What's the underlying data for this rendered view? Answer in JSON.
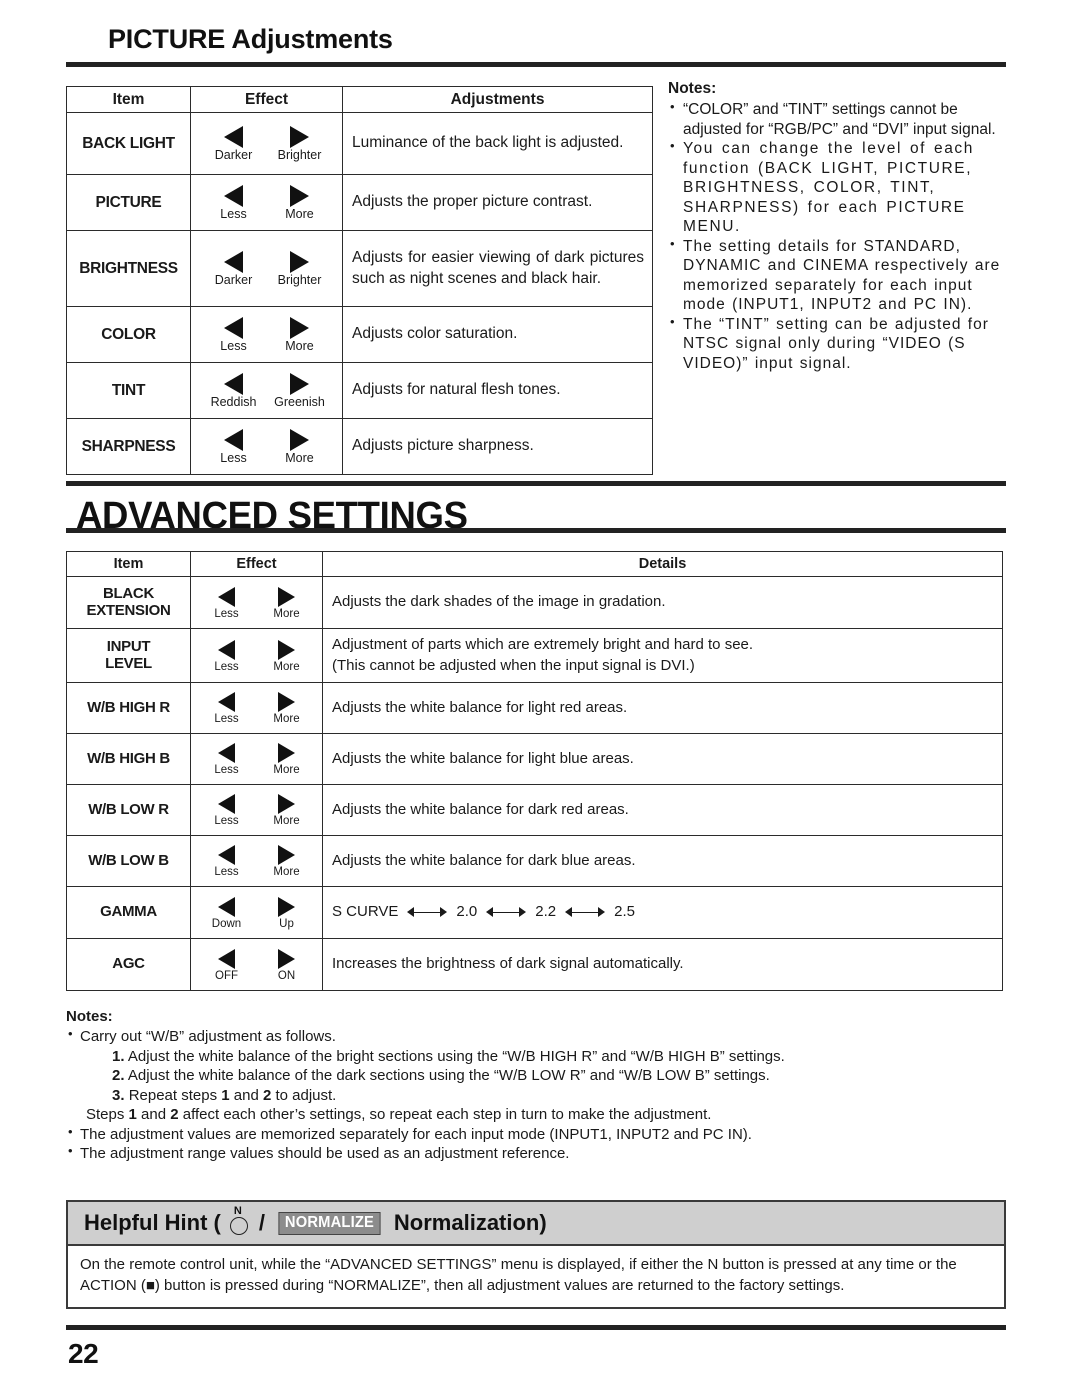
{
  "page_number": "22",
  "picture_section": {
    "title": "PICTURE Adjustments",
    "table": {
      "headers": [
        "Item",
        "Effect",
        "Adjustments"
      ],
      "rows": [
        {
          "item": "BACK LIGHT",
          "left_label": "Darker",
          "right_label": "Brighter",
          "desc": "Luminance of the back light is adjusted."
        },
        {
          "item": "PICTURE",
          "left_label": "Less",
          "right_label": "More",
          "desc": "Adjusts the proper picture contrast."
        },
        {
          "item": "BRIGHTNESS",
          "left_label": "Darker",
          "right_label": "Brighter",
          "desc": "Adjusts for easier viewing of dark pictures such as night scenes and black hair."
        },
        {
          "item": "COLOR",
          "left_label": "Less",
          "right_label": "More",
          "desc": "Adjusts color saturation."
        },
        {
          "item": "TINT",
          "left_label": "Reddish",
          "right_label": "Greenish",
          "desc": "Adjusts for natural flesh tones."
        },
        {
          "item": "SHARPNESS",
          "left_label": "Less",
          "right_label": "More",
          "desc": "Adjusts picture sharpness."
        }
      ]
    },
    "notes": {
      "heading": "Notes:",
      "items": [
        "“COLOR” and “TINT” settings cannot be adjusted for “RGB/PC” and “DVI” input signal.",
        "You can change the level of each function (BACK LIGHT, PICTURE, BRIGHTNESS, COLOR, TINT, SHARPNESS) for each PICTURE MENU.",
        "The setting details for STANDARD, DYNAMIC and CINEMA respectively are memorized separately for each input mode  (INPUT1, INPUT2 and PC IN).",
        "The “TINT” setting can be adjusted for NTSC signal only during “VIDEO (S VIDEO)” input signal."
      ]
    }
  },
  "advanced_section": {
    "title": "ADVANCED SETTINGS",
    "table": {
      "headers": [
        "Item",
        "Effect",
        "Details"
      ],
      "rows": [
        {
          "item": "BLACK\nEXTENSION",
          "left_label": "Less",
          "right_label": "More",
          "desc": "Adjusts the dark shades of the image in gradation."
        },
        {
          "item": "INPUT\nLEVEL",
          "left_label": "Less",
          "right_label": "More",
          "desc": "Adjustment of parts which are extremely bright and hard to see.\n(This cannot be adjusted when the input signal is DVI.)"
        },
        {
          "item": "W/B HIGH R",
          "left_label": "Less",
          "right_label": "More",
          "desc": "Adjusts the white balance for light red areas."
        },
        {
          "item": "W/B HIGH B",
          "left_label": "Less",
          "right_label": "More",
          "desc": "Adjusts the white balance for light blue areas."
        },
        {
          "item": "W/B LOW R",
          "left_label": "Less",
          "right_label": "More",
          "desc": "Adjusts the white balance for dark red areas."
        },
        {
          "item": "W/B LOW B",
          "left_label": "Less",
          "right_label": "More",
          "desc": "Adjusts the white balance for dark blue areas."
        },
        {
          "item": "GAMMA",
          "left_label": "Down",
          "right_label": "Up",
          "desc": "",
          "gamma_values": [
            "S CURVE",
            "2.0",
            "2.2",
            "2.5"
          ]
        },
        {
          "item": "AGC",
          "left_label": "OFF",
          "right_label": "ON",
          "desc": "Increases the brightness of dark signal automatically."
        }
      ]
    },
    "notes": {
      "heading": "Notes:",
      "bullet1": "Carry out “W/B” adjustment as follows.",
      "steps": [
        {
          "num": "1.",
          "text": "Adjust the white balance of the bright sections using the “W/B HIGH R” and “W/B HIGH B” settings."
        },
        {
          "num": "2.",
          "text": "Adjust the white balance of the dark sections using the “W/B LOW R” and “W/B LOW B” settings."
        },
        {
          "num": "3.",
          "text": "Repeat steps 1 and 2 to adjust."
        }
      ],
      "steps_tail": "Steps 1 and 2 affect each other’s settings, so repeat each step in turn to make the adjustment.",
      "bullet2": "The adjustment values are memorized separately for each input mode (INPUT1, INPUT2 and PC IN).",
      "bullet3": "The adjustment range values should be used as an adjustment reference."
    }
  },
  "helpful_hint": {
    "prefix": "Helpful Hint (",
    "n_button_label": "N",
    "separator": "/",
    "normalize_badge": "NORMALIZE",
    "suffix": "Normalization)",
    "body": "On the remote control unit, while the “ADVANCED SETTINGS” menu is displayed, if either the N button is pressed at any time or the ACTION (■) button is pressed during “NORMALIZE”, then all adjustment values are returned to the factory settings."
  },
  "colors": {
    "rule": "#222222",
    "table_border": "#2b2b2b",
    "hint_header_bg": "#cfcfcf",
    "normalize_bg": "#8c8c8c"
  }
}
